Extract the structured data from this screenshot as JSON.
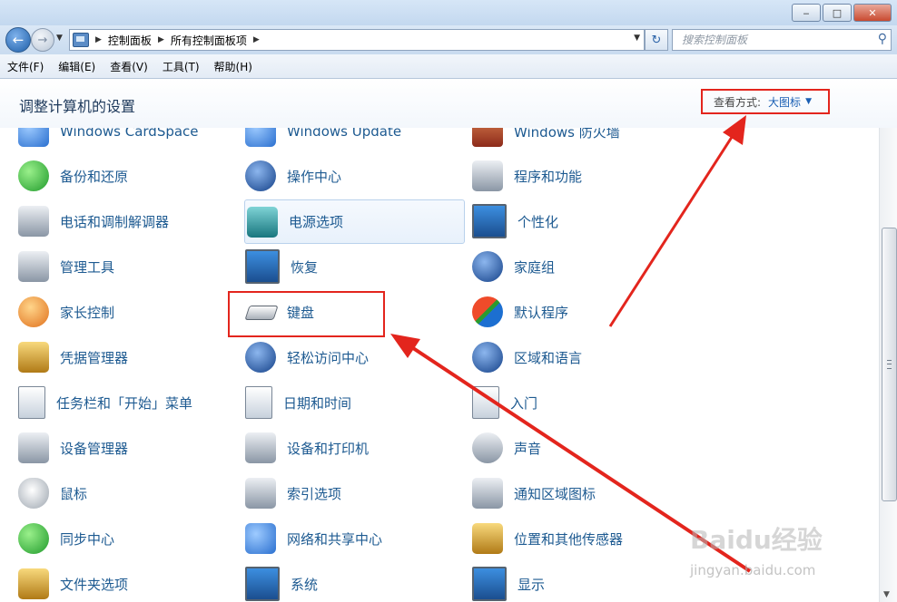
{
  "window": {
    "minimize_glyph": "‒",
    "maximize_glyph": "□",
    "close_glyph": "✕"
  },
  "address": {
    "back_glyph": "←",
    "forward_glyph": "→",
    "crumbs": [
      "控制面板",
      "所有控制面板项"
    ],
    "sep_glyph": "▶",
    "refresh_glyph": "↻",
    "search_placeholder": "搜索控制面板"
  },
  "menu": [
    "文件(F)",
    "编辑(E)",
    "查看(V)",
    "工具(T)",
    "帮助(H)"
  ],
  "header": {
    "title": "调整计算机的设置",
    "view_by_label": "查看方式:",
    "view_by_value": "大图标",
    "view_by_arrow": "▼"
  },
  "items": {
    "col1": [
      {
        "label": "Windows CardSpace",
        "icon": "cardspace-icon"
      },
      {
        "label": "备份和还原",
        "icon": "backup-restore-icon"
      },
      {
        "label": "电话和调制解调器",
        "icon": "phone-modem-icon"
      },
      {
        "label": "管理工具",
        "icon": "admin-tools-icon"
      },
      {
        "label": "家长控制",
        "icon": "parental-controls-icon"
      },
      {
        "label": "凭据管理器",
        "icon": "credential-manager-icon"
      },
      {
        "label": "任务栏和「开始」菜单",
        "icon": "taskbar-icon"
      },
      {
        "label": "设备管理器",
        "icon": "device-manager-icon"
      },
      {
        "label": "鼠标",
        "icon": "mouse-icon"
      },
      {
        "label": "同步中心",
        "icon": "sync-center-icon"
      },
      {
        "label": "文件夹选项",
        "icon": "folder-options-icon"
      }
    ],
    "col2": [
      {
        "label": "Windows Update",
        "icon": "windows-update-icon"
      },
      {
        "label": "操作中心",
        "icon": "action-center-icon"
      },
      {
        "label": "电源选项",
        "icon": "power-options-icon"
      },
      {
        "label": "恢复",
        "icon": "recovery-icon"
      },
      {
        "label": "键盘",
        "icon": "keyboard-icon"
      },
      {
        "label": "轻松访问中心",
        "icon": "ease-of-access-icon"
      },
      {
        "label": "日期和时间",
        "icon": "date-time-icon"
      },
      {
        "label": "设备和打印机",
        "icon": "devices-printers-icon"
      },
      {
        "label": "索引选项",
        "icon": "indexing-options-icon"
      },
      {
        "label": "网络和共享中心",
        "icon": "network-sharing-icon"
      },
      {
        "label": "系统",
        "icon": "system-icon"
      }
    ],
    "col3": [
      {
        "label": "Windows 防火墙",
        "icon": "firewall-icon"
      },
      {
        "label": "程序和功能",
        "icon": "programs-features-icon"
      },
      {
        "label": "个性化",
        "icon": "personalization-icon"
      },
      {
        "label": "家庭组",
        "icon": "homegroup-icon"
      },
      {
        "label": "默认程序",
        "icon": "default-programs-icon"
      },
      {
        "label": "区域和语言",
        "icon": "region-language-icon"
      },
      {
        "label": "入门",
        "icon": "getting-started-icon"
      },
      {
        "label": "声音",
        "icon": "sound-icon"
      },
      {
        "label": "通知区域图标",
        "icon": "notification-area-icon"
      },
      {
        "label": "位置和其他传感器",
        "icon": "location-sensors-icon"
      },
      {
        "label": "显示",
        "icon": "display-icon"
      }
    ]
  },
  "watermark": {
    "brand": "Baidu经验",
    "url": "jingyan.baidu.com"
  },
  "colors": {
    "annotation_red": "#e3251d",
    "link_blue": "#1d5a91"
  }
}
